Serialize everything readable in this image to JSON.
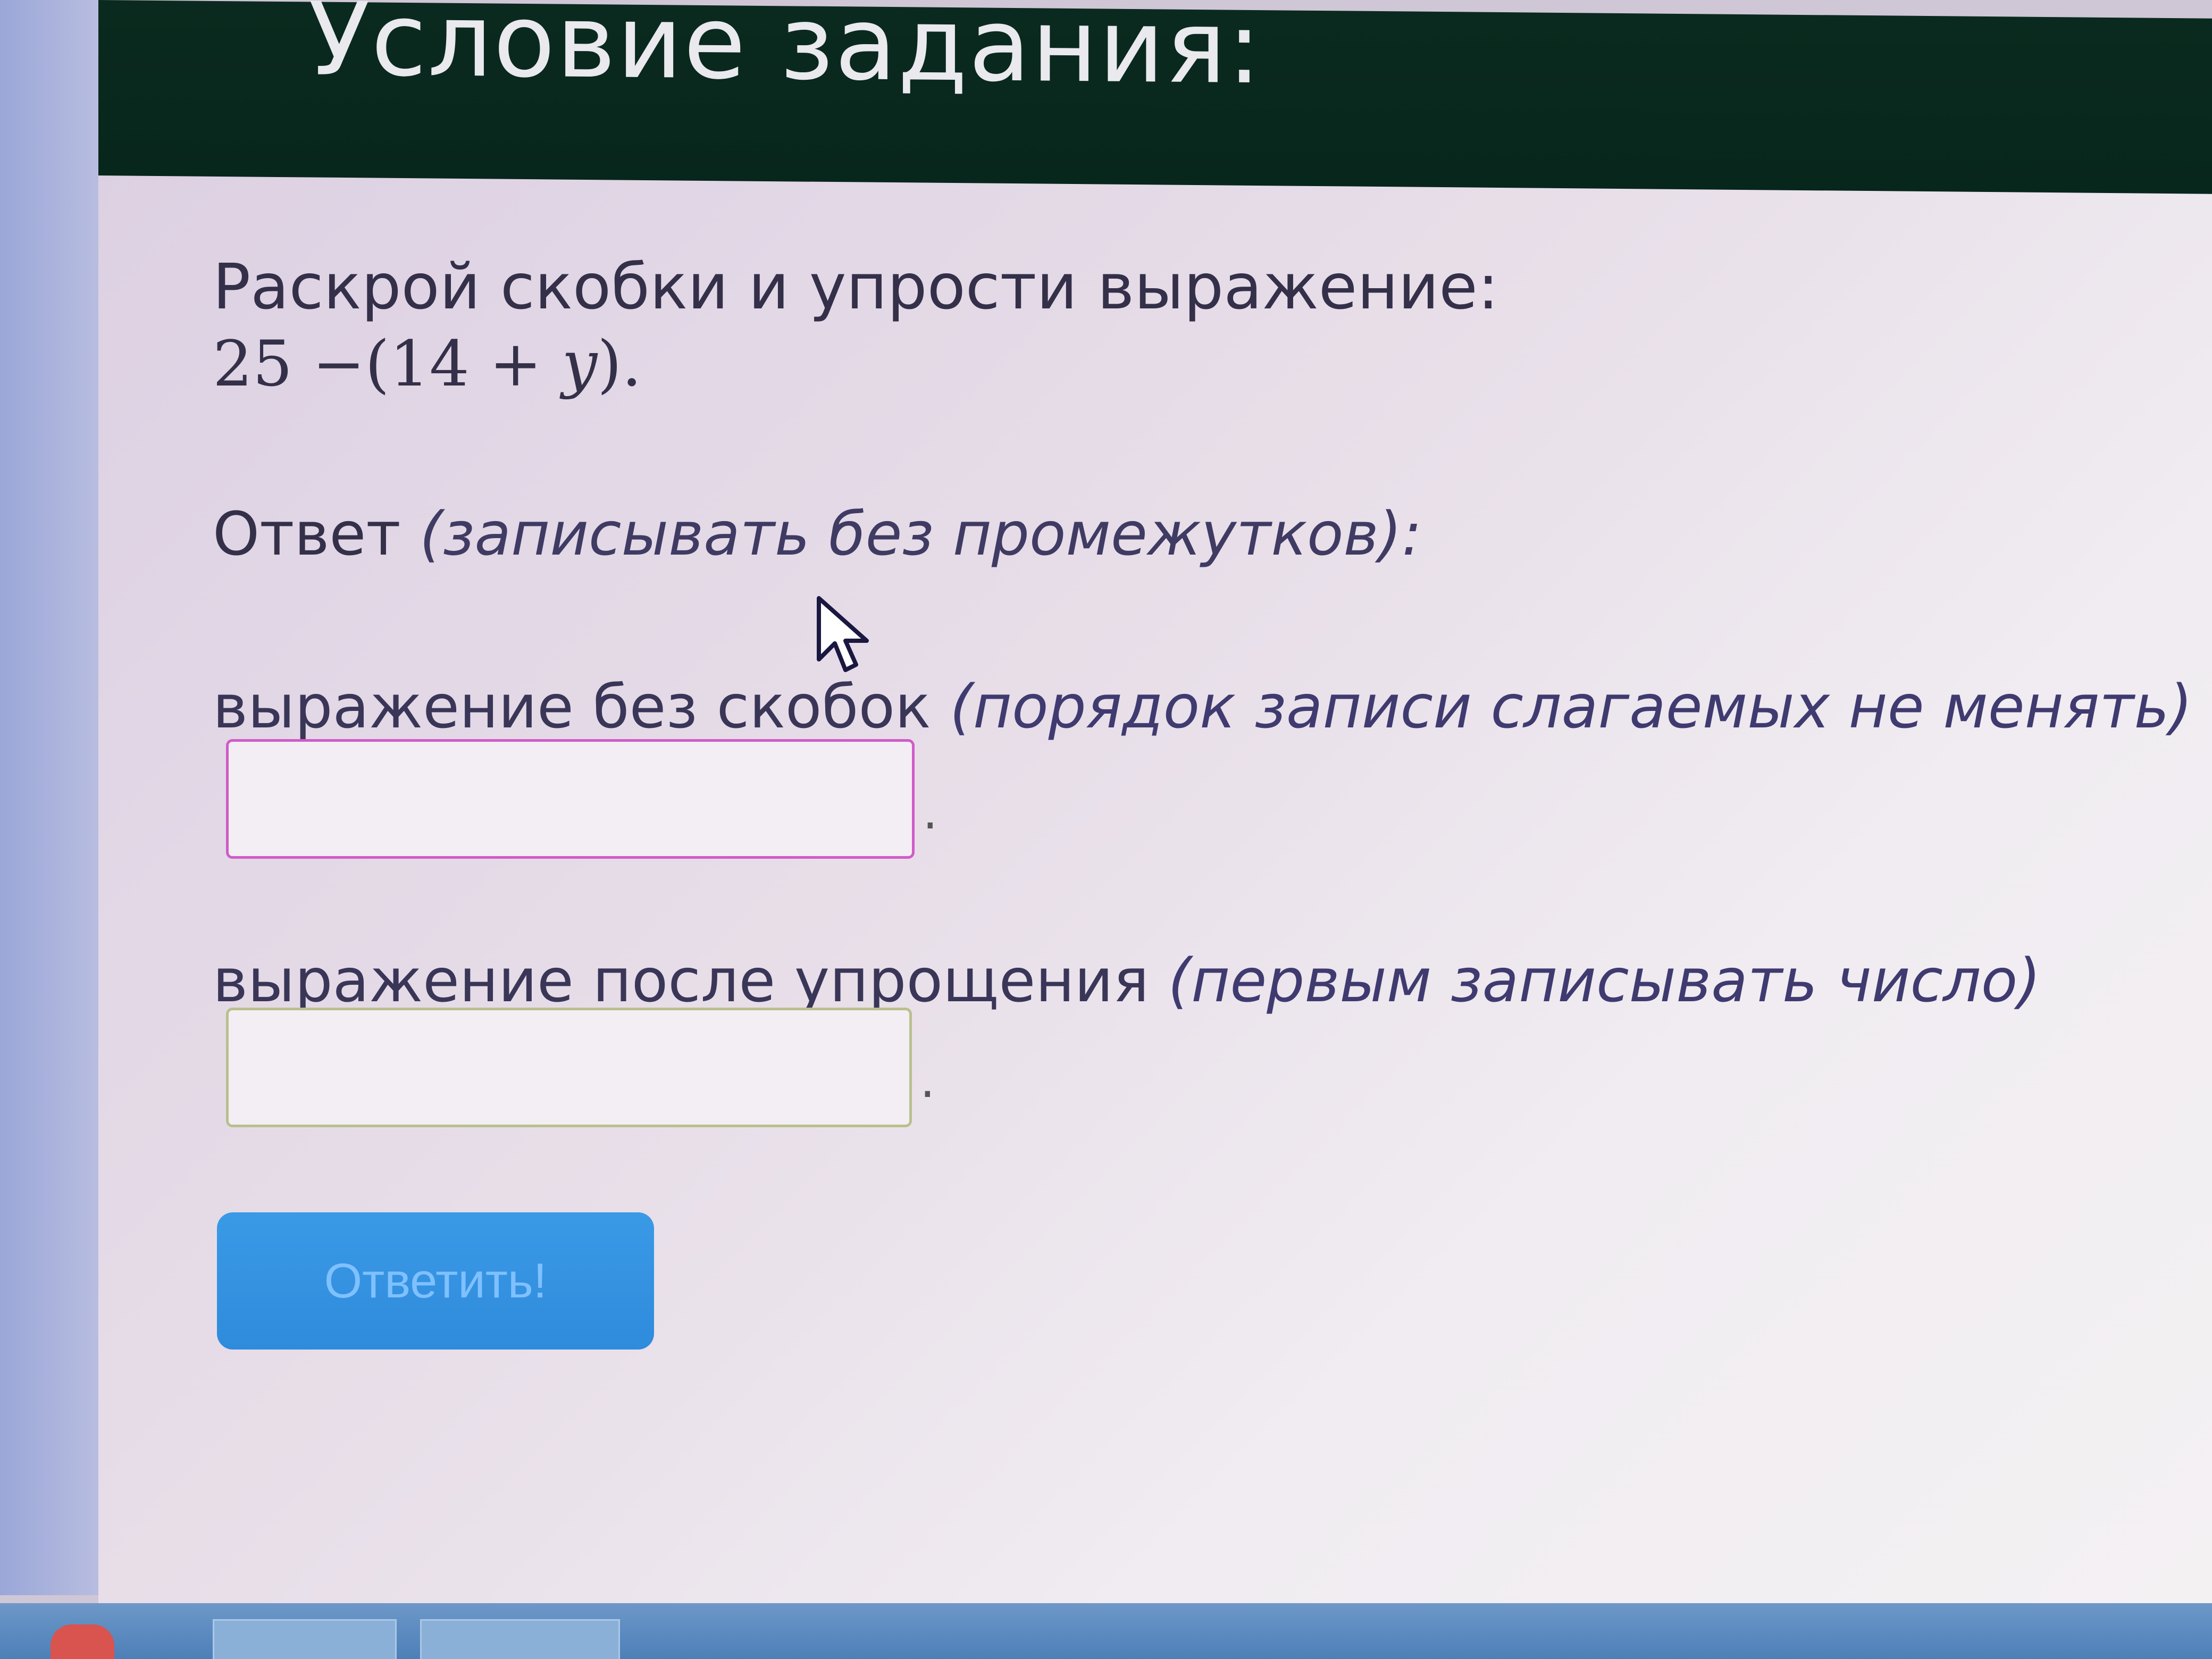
{
  "header": {
    "title": "Условие задания:"
  },
  "task": {
    "instruction": "Раскрой скобки и упрости выражение:",
    "expression_prefix": "25 −(14 + ",
    "expression_variable": "y",
    "expression_suffix": ")."
  },
  "answer": {
    "label_main": "Ответ ",
    "label_hint": "(записывать без промежутков):"
  },
  "fields": [
    {
      "label_main": "выражение без скобок ",
      "label_hint": "(порядок записи слагаемых не менять)",
      "value": "",
      "trailing": "."
    },
    {
      "label_main": "выражение после упрощения ",
      "label_hint": "(первым записывать число)",
      "value": "",
      "trailing": "."
    }
  ],
  "submit": {
    "label": "Ответить!"
  },
  "colors": {
    "header_bg": "#0b2a1f",
    "text": "#343049",
    "field1_border": "#d05bc8",
    "field2_border": "#b9c08d",
    "button_bg": "#3a9ae6",
    "button_text": "#7fc0ff"
  },
  "icons": {
    "cursor": "mouse-pointer-icon"
  }
}
